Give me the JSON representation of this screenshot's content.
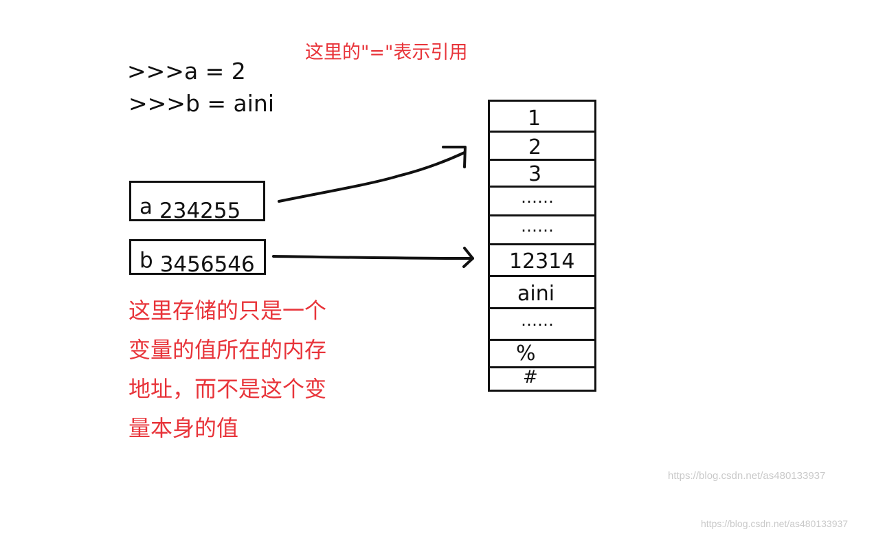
{
  "title": "这里的\"=\"表示引用",
  "code_lines": [
    ">>>a = 2",
    ">>>b = aini"
  ],
  "variables": [
    {
      "name": "a",
      "address": "234255"
    },
    {
      "name": "b",
      "address": "3456546"
    }
  ],
  "note_lines": [
    "这里存储的只是一个",
    "变量的值所在的内存",
    "地址，而不是这个变",
    "量本身的值"
  ],
  "memory_cells": [
    "1",
    "2",
    "3",
    "……",
    "……",
    "12314",
    "aini",
    "……",
    "%",
    "#"
  ],
  "watermarks": [
    "https://blog.csdn.net/as480133937",
    "https://blog.csdn.net/as480133937"
  ],
  "colors": {
    "annotation": "#e8343a",
    "ink": "#111111"
  }
}
